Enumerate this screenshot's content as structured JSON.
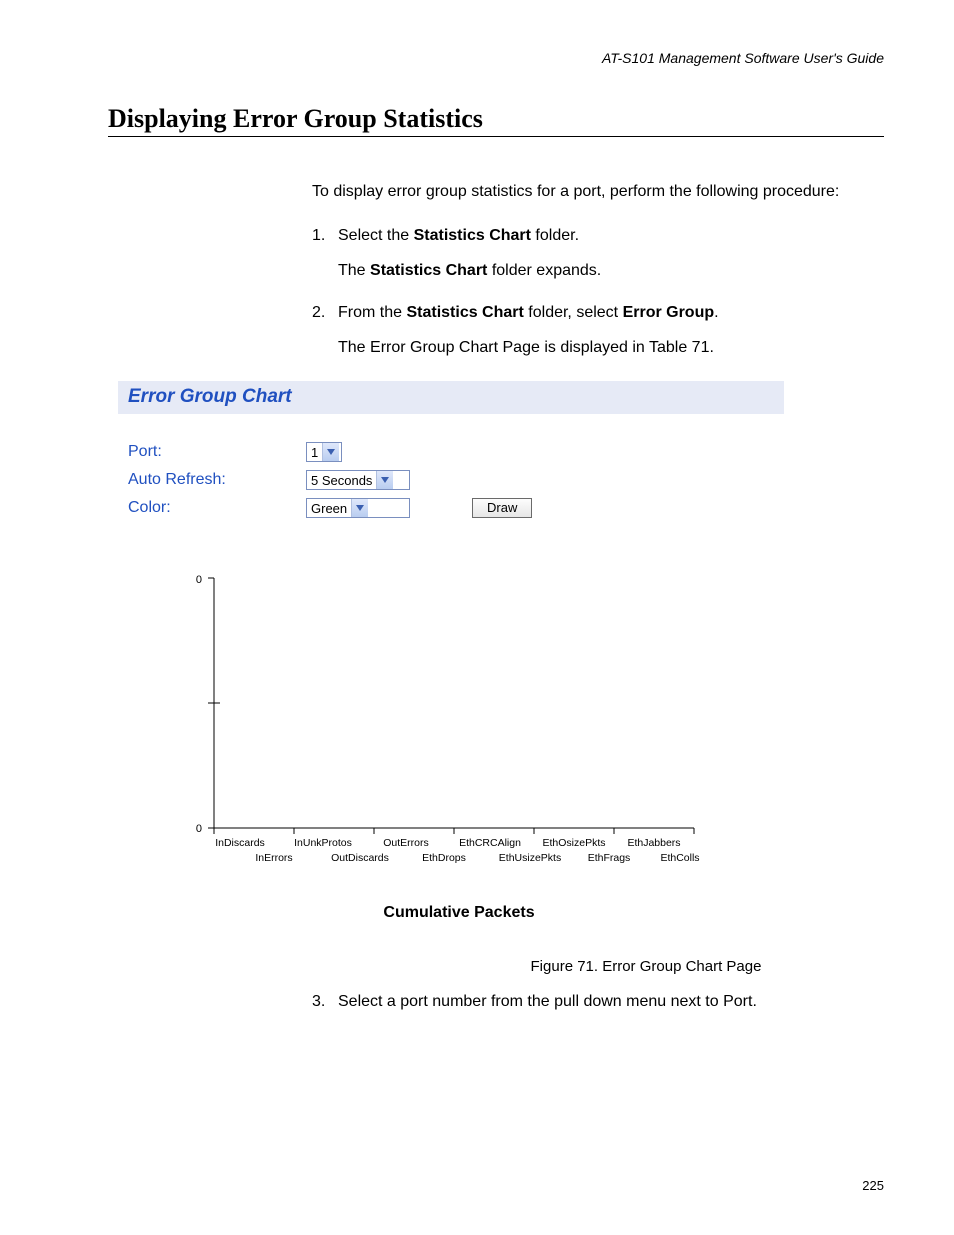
{
  "header": "AT-S101 Management Software User's Guide",
  "section_title": "Displaying Error Group Statistics",
  "intro": "To display error group statistics for a port, perform the following procedure:",
  "steps": [
    {
      "num": "1.",
      "body_prefix": "Select the ",
      "body_bold": "Statistics Chart",
      "body_suffix": " folder.",
      "follow_prefix": "The ",
      "follow_bold": "Statistics Chart",
      "follow_suffix": " folder expands."
    },
    {
      "num": "2.",
      "body_prefix": "From the ",
      "body_bold": "Statistics Chart",
      "body_mid": " folder, select ",
      "body_bold2": "Error Group",
      "body_suffix": ".",
      "follow_plain": "The Error Group Chart Page is displayed in Table 71."
    }
  ],
  "panel": {
    "title": "Error Group Chart",
    "rows": {
      "port_label": "Port:",
      "port_value": "1",
      "refresh_label": "Auto Refresh:",
      "refresh_value": "5 Seconds",
      "color_label": "Color:",
      "color_value": "Green",
      "draw_button": "Draw"
    }
  },
  "chart_data": {
    "type": "bar",
    "categories_top": [
      "InDiscards",
      "InUnkProtos",
      "OutErrors",
      "EthCRCAlign",
      "EthOsizePkts",
      "EthJabbers"
    ],
    "categories_bottom": [
      "InErrors",
      "OutDiscards",
      "EthDrops",
      "EthUsizePkts",
      "EthFrags",
      "EthColls"
    ],
    "values": [
      0,
      0,
      0,
      0,
      0,
      0,
      0,
      0,
      0,
      0,
      0,
      0
    ],
    "ylim": [
      0,
      0
    ],
    "y_ticks": [
      "0",
      "0"
    ],
    "xlabel": "Cumulative Packets",
    "ylabel": "",
    "title": ""
  },
  "figure_caption": "Figure 71. Error Group Chart Page",
  "step3": {
    "num": "3.",
    "text": "Select a port number from the pull down menu next to Port."
  },
  "page_number": "225"
}
